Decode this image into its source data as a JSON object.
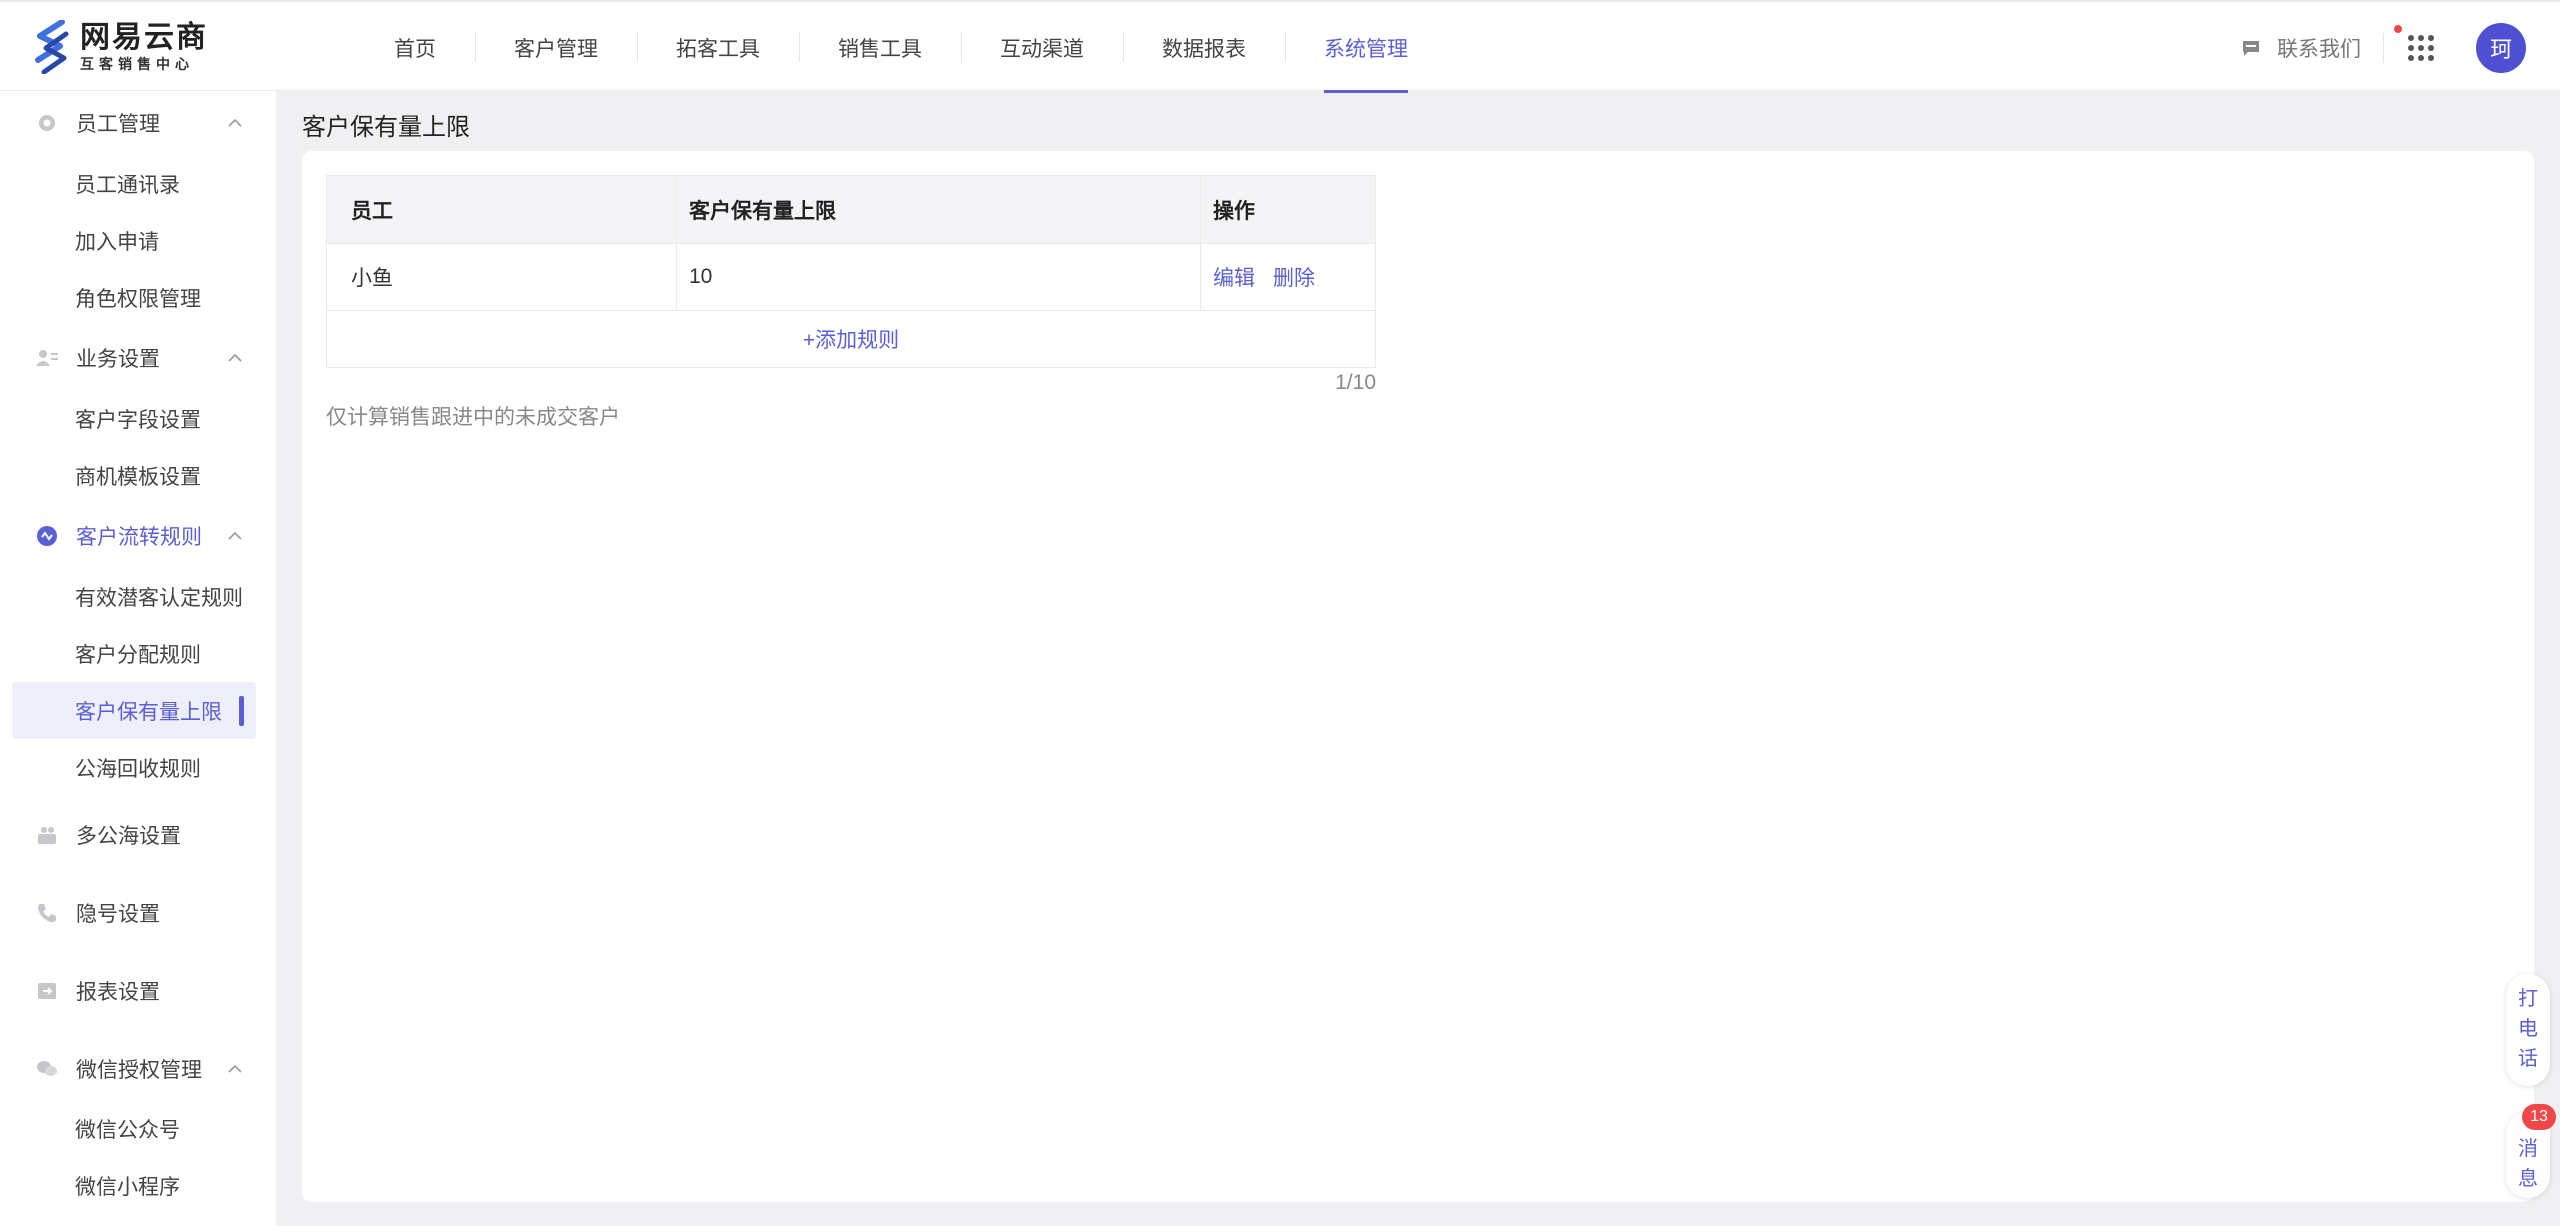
{
  "brand": {
    "name": "网易云商",
    "subtitle": "互客销售中心"
  },
  "nav": {
    "items": [
      "首页",
      "客户管理",
      "拓客工具",
      "销售工具",
      "互动渠道",
      "数据报表",
      "系统管理"
    ],
    "active_index": 6
  },
  "header": {
    "contact_label": "联系我们",
    "avatar_text": "珂"
  },
  "sidebar": {
    "staff": {
      "label": "员工管理",
      "items": [
        "员工通讯录",
        "加入申请",
        "角色权限管理"
      ]
    },
    "business": {
      "label": "业务设置",
      "items": [
        "客户字段设置",
        "商机模板设置"
      ]
    },
    "flow": {
      "label": "客户流转规则",
      "items": [
        "有效潜客认定规则",
        "客户分配规则",
        "客户保有量上限",
        "公海回收规则"
      ],
      "active_index": 2
    },
    "multi_sea": {
      "label": "多公海设置"
    },
    "privacy": {
      "label": "隐号设置"
    },
    "report": {
      "label": "报表设置"
    },
    "wechat": {
      "label": "微信授权管理",
      "items": [
        "微信公众号",
        "微信小程序"
      ]
    }
  },
  "page": {
    "title": "客户保有量上限",
    "table": {
      "headers": [
        "员工",
        "客户保有量上限",
        "操作"
      ],
      "rows": [
        {
          "employee": "小鱼",
          "limit": "10",
          "edit": "编辑",
          "delete": "删除"
        }
      ],
      "add_label": "+添加规则"
    },
    "counter": "1/10",
    "hint": "仅计算销售跟进中的未成交客户"
  },
  "float": {
    "call_label": [
      "打",
      "电",
      "话"
    ],
    "msg_label": [
      "消",
      "息"
    ],
    "msg_badge": "13"
  },
  "colors": {
    "accent": "#5a5fd6",
    "badge": "#f04848"
  }
}
